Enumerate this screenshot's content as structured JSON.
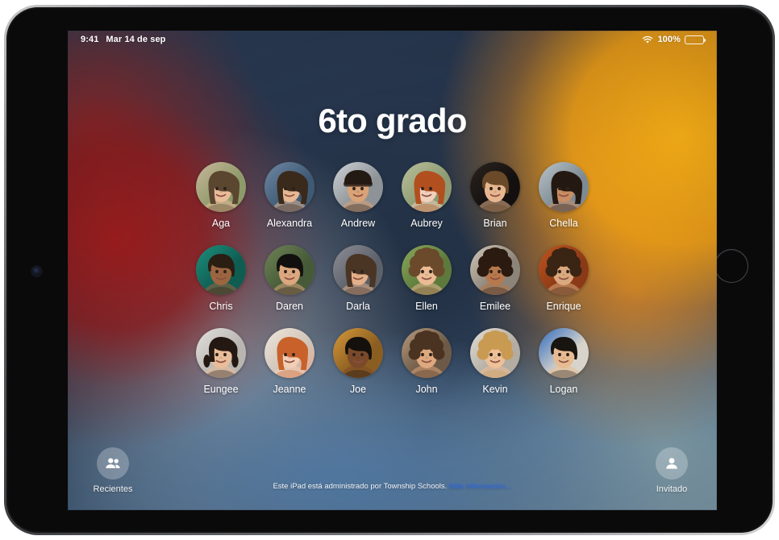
{
  "device": {
    "type": "ipad",
    "camera_icon": "camera-lens",
    "home_button_icon": "home-button"
  },
  "status_bar": {
    "time": "9:41",
    "date": "Mar 14 de sep",
    "wifi_icon": "wifi-icon",
    "battery_percent": "100%",
    "battery_icon": "battery-icon",
    "battery_level": 100
  },
  "header": {
    "title": "6to grado"
  },
  "users": {
    "rows": [
      [
        {
          "name": "Aga",
          "avatar": "avatar-aga"
        },
        {
          "name": "Alexandra",
          "avatar": "avatar-alexandra"
        },
        {
          "name": "Andrew",
          "avatar": "avatar-andrew"
        },
        {
          "name": "Aubrey",
          "avatar": "avatar-aubrey"
        },
        {
          "name": "Brian",
          "avatar": "avatar-brian"
        },
        {
          "name": "Chella",
          "avatar": "avatar-chella"
        }
      ],
      [
        {
          "name": "Chris",
          "avatar": "avatar-chris"
        },
        {
          "name": "Daren",
          "avatar": "avatar-daren"
        },
        {
          "name": "Darla",
          "avatar": "avatar-darla"
        },
        {
          "name": "Ellen",
          "avatar": "avatar-ellen"
        },
        {
          "name": "Emilee",
          "avatar": "avatar-emilee"
        },
        {
          "name": "Enrique",
          "avatar": "avatar-enrique"
        }
      ],
      [
        {
          "name": "Eungee",
          "avatar": "avatar-eungee"
        },
        {
          "name": "Jeanne",
          "avatar": "avatar-jeanne"
        },
        {
          "name": "Joe",
          "avatar": "avatar-joe"
        },
        {
          "name": "John",
          "avatar": "avatar-john"
        },
        {
          "name": "Kevin",
          "avatar": "avatar-kevin"
        },
        {
          "name": "Logan",
          "avatar": "avatar-logan"
        }
      ]
    ]
  },
  "bottom_bar": {
    "recents": {
      "label": "Recientes",
      "icon": "two-people-icon"
    },
    "guest": {
      "label": "Invitado",
      "icon": "person-icon"
    },
    "managed_note": "Este iPad está administrado por Township Schools.",
    "managed_link": "Más información...",
    "link_color": "#2f6df0"
  },
  "colors": {
    "wallpaper_dark": "#25344A",
    "wallpaper_red": "#8B2020",
    "wallpaper_orange": "#EE9818",
    "wallpaper_blue": "#50789E",
    "text_primary": "#FFFFFF",
    "link": "#2F6DF0"
  }
}
